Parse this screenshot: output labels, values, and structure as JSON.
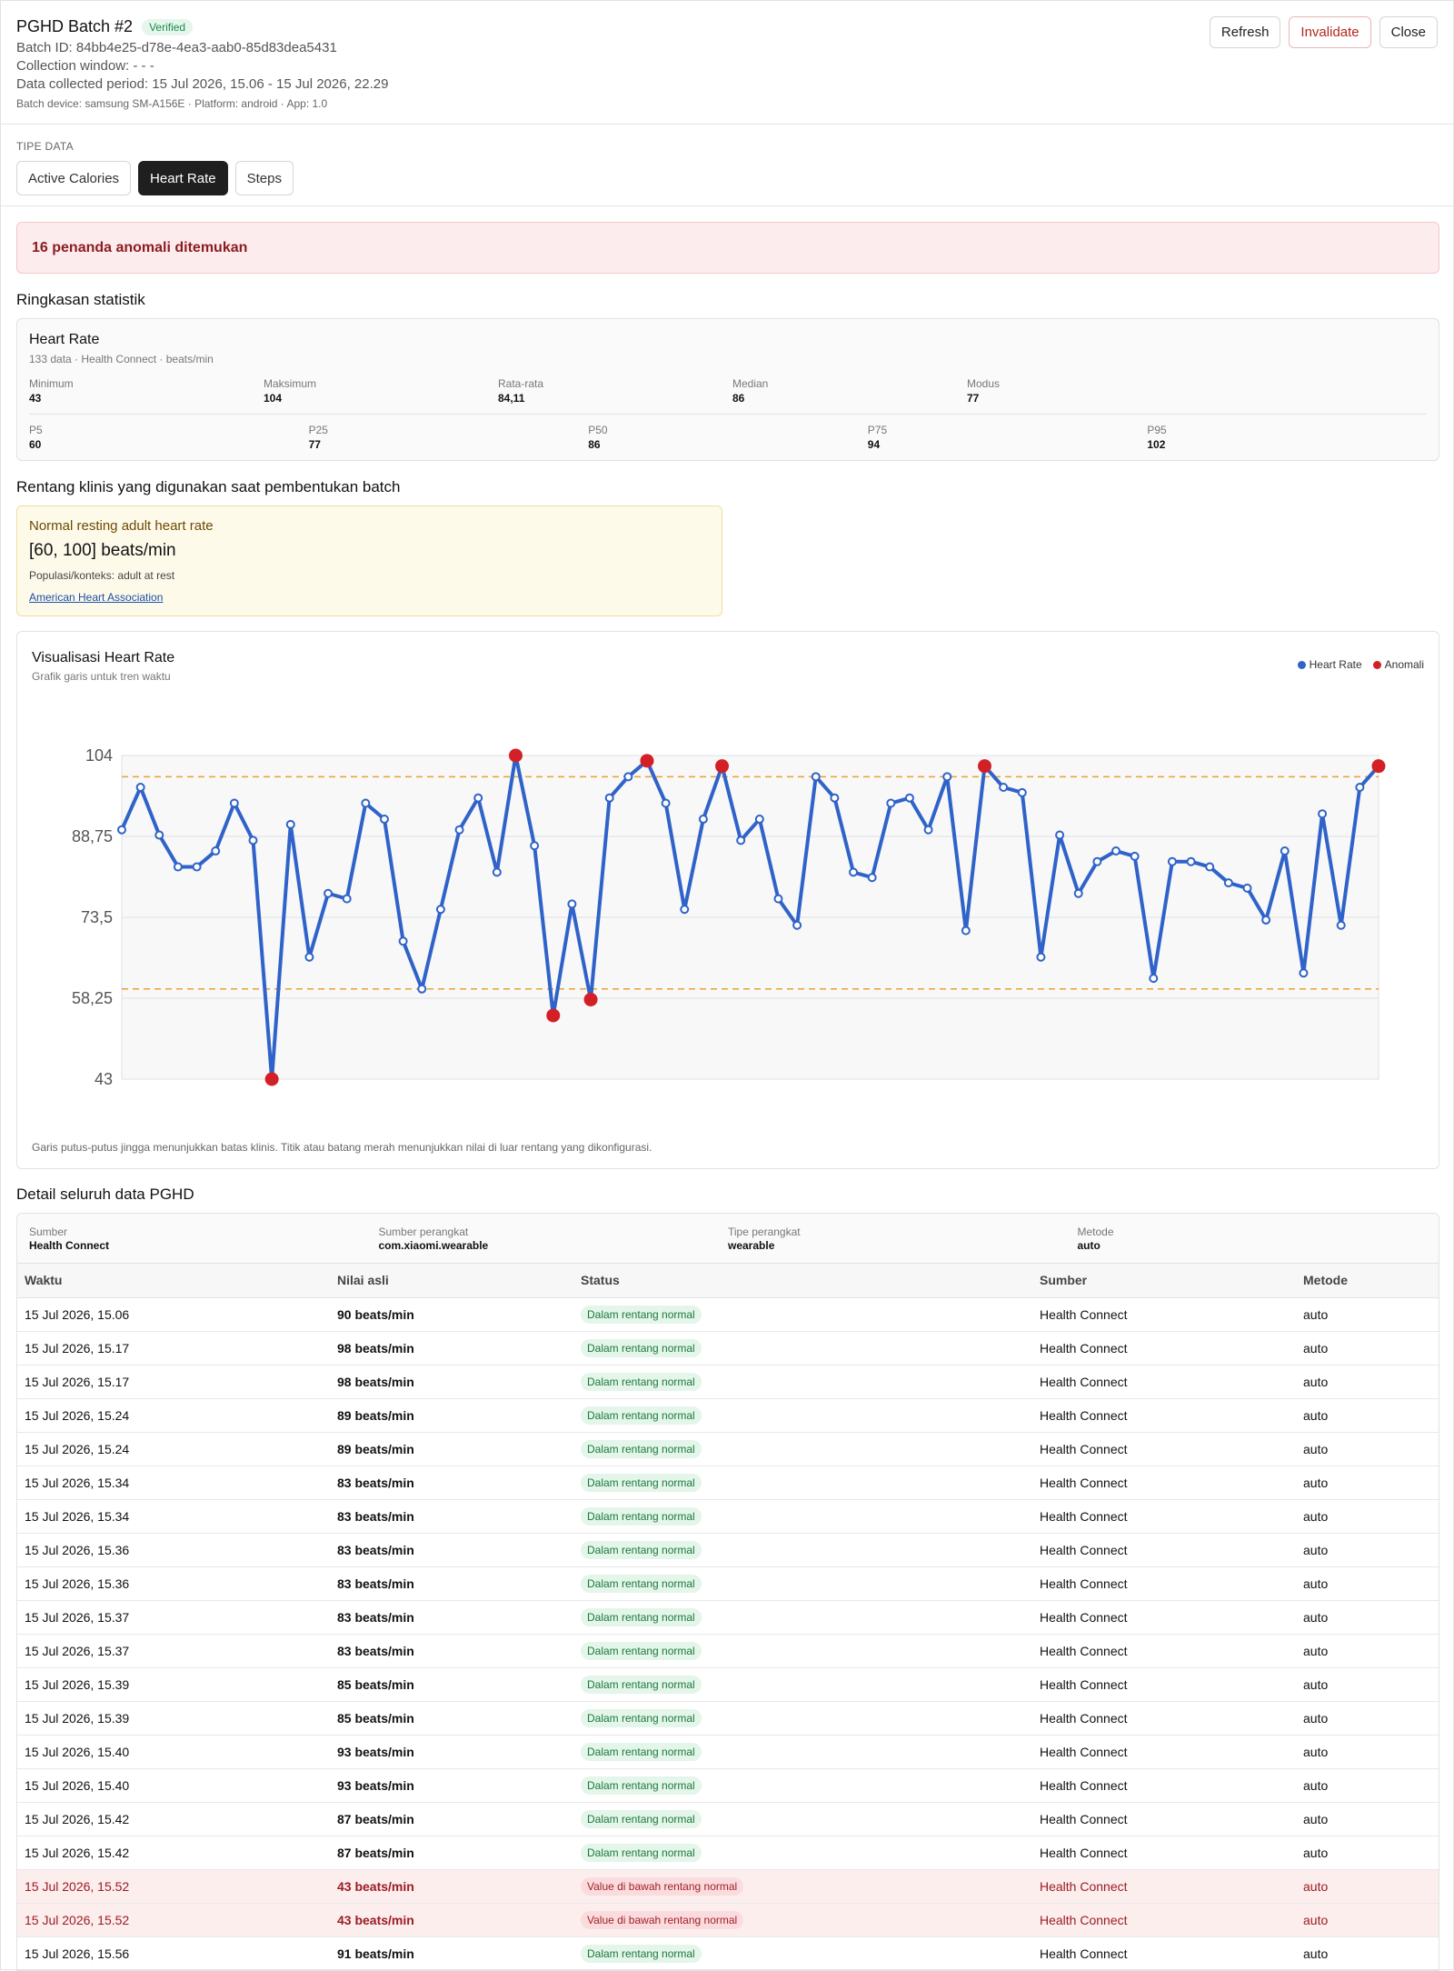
{
  "header": {
    "title": "PGHD Batch #2",
    "verified": "Verified",
    "batch_id": "Batch ID: 84bb4e25-d78e-4ea3-aab0-85d83dea5431",
    "collection_window": "Collection window: - - -",
    "period": "Data collected period: 15 Jul 2026, 15.06 - 15 Jul 2026, 22.29",
    "device": "Batch device: samsung SM-A156E · Platform: android · App: 1.0",
    "buttons": {
      "refresh": "Refresh",
      "invalidate": "Invalidate",
      "close": "Close"
    }
  },
  "types": {
    "label": "TIPE DATA",
    "tabs": [
      "Active Calories",
      "Heart Rate",
      "Steps"
    ],
    "active": "Heart Rate"
  },
  "alert": "16 penanda anomali ditemukan",
  "summary": {
    "section_title": "Ringkasan statistik",
    "title": "Heart Rate",
    "sub": "133 data · Health Connect · beats/min",
    "top": [
      {
        "k": "Minimum",
        "v": "43"
      },
      {
        "k": "Maksimum",
        "v": "104"
      },
      {
        "k": "Rata-rata",
        "v": "84,11"
      },
      {
        "k": "Median",
        "v": "86"
      },
      {
        "k": "Modus",
        "v": "77"
      }
    ],
    "bottom": [
      {
        "k": "P5",
        "v": "60"
      },
      {
        "k": "P25",
        "v": "77"
      },
      {
        "k": "P50",
        "v": "86"
      },
      {
        "k": "P75",
        "v": "94"
      },
      {
        "k": "P95",
        "v": "102"
      }
    ]
  },
  "clinical": {
    "section_title": "Rentang klinis yang digunakan saat pembentukan batch",
    "name": "Normal resting adult heart rate",
    "range": "[60, 100] beats/min",
    "population": "Populasi/konteks: adult at rest",
    "source": "American Heart Association"
  },
  "chart": {
    "title": "Visualisasi Heart Rate",
    "subtitle": "Grafik garis untuk tren waktu",
    "note": "Garis putus-putus jingga menunjukkan batas klinis. Titik atau batang merah menunjukkan nilai di luar rentang yang dikonfigurasi.",
    "colors": {
      "line": "#2f63c9",
      "anomaly": "#d32026",
      "limit": "#e8a235",
      "plot_bg": "#f8f8f8",
      "grid": "#e0e0e0"
    }
  },
  "chart_data": {
    "type": "line",
    "title": "Visualisasi Heart Rate",
    "ylim": [
      43,
      104
    ],
    "y_ticks": [
      "104",
      "88,75",
      "73,5",
      "58,25",
      "43"
    ],
    "y_tick_values": [
      104,
      88.75,
      73.5,
      58.25,
      43
    ],
    "limits": [
      60,
      100
    ],
    "grid": true,
    "legend_position": "top-right",
    "series": [
      {
        "name": "Heart Rate",
        "values": [
          90,
          98,
          89,
          83,
          83,
          86,
          95,
          88,
          43,
          91,
          66,
          78,
          77,
          95,
          92,
          69,
          60,
          75,
          90,
          96,
          82,
          104,
          87,
          55,
          76,
          58,
          96,
          100,
          103,
          95,
          75,
          92,
          102,
          88,
          92,
          77,
          72,
          100,
          96,
          82,
          81,
          95,
          96,
          90,
          100,
          71,
          102,
          98,
          97,
          66,
          89,
          78,
          84,
          86,
          85,
          62,
          84,
          84,
          83,
          80,
          79,
          73,
          86,
          63,
          93,
          72,
          98,
          102
        ]
      },
      {
        "name": "Anomali",
        "values": [
          43,
          104,
          55,
          58,
          103,
          101,
          102,
          102
        ]
      }
    ],
    "legend": [
      "Heart Rate",
      "Anomali"
    ]
  },
  "detail": {
    "section_title": "Detail seluruh data PGHD",
    "meta": [
      {
        "k": "Sumber",
        "v": "Health Connect"
      },
      {
        "k": "Sumber perangkat",
        "v": "com.xiaomi.wearable"
      },
      {
        "k": "Tipe perangkat",
        "v": "wearable"
      },
      {
        "k": "Metode",
        "v": "auto"
      }
    ],
    "columns": [
      "Waktu",
      "Nilai asli",
      "Status",
      "Sumber",
      "Metode"
    ],
    "rows": [
      {
        "time": "15 Jul 2026, 15.06",
        "value": "90 beats/min",
        "status": "Dalam rentang normal",
        "source": "Health Connect",
        "method": "auto",
        "anomaly": false
      },
      {
        "time": "15 Jul 2026, 15.17",
        "value": "98 beats/min",
        "status": "Dalam rentang normal",
        "source": "Health Connect",
        "method": "auto",
        "anomaly": false
      },
      {
        "time": "15 Jul 2026, 15.17",
        "value": "98 beats/min",
        "status": "Dalam rentang normal",
        "source": "Health Connect",
        "method": "auto",
        "anomaly": false
      },
      {
        "time": "15 Jul 2026, 15.24",
        "value": "89 beats/min",
        "status": "Dalam rentang normal",
        "source": "Health Connect",
        "method": "auto",
        "anomaly": false
      },
      {
        "time": "15 Jul 2026, 15.24",
        "value": "89 beats/min",
        "status": "Dalam rentang normal",
        "source": "Health Connect",
        "method": "auto",
        "anomaly": false
      },
      {
        "time": "15 Jul 2026, 15.34",
        "value": "83 beats/min",
        "status": "Dalam rentang normal",
        "source": "Health Connect",
        "method": "auto",
        "anomaly": false
      },
      {
        "time": "15 Jul 2026, 15.34",
        "value": "83 beats/min",
        "status": "Dalam rentang normal",
        "source": "Health Connect",
        "method": "auto",
        "anomaly": false
      },
      {
        "time": "15 Jul 2026, 15.36",
        "value": "83 beats/min",
        "status": "Dalam rentang normal",
        "source": "Health Connect",
        "method": "auto",
        "anomaly": false
      },
      {
        "time": "15 Jul 2026, 15.36",
        "value": "83 beats/min",
        "status": "Dalam rentang normal",
        "source": "Health Connect",
        "method": "auto",
        "anomaly": false
      },
      {
        "time": "15 Jul 2026, 15.37",
        "value": "83 beats/min",
        "status": "Dalam rentang normal",
        "source": "Health Connect",
        "method": "auto",
        "anomaly": false
      },
      {
        "time": "15 Jul 2026, 15.37",
        "value": "83 beats/min",
        "status": "Dalam rentang normal",
        "source": "Health Connect",
        "method": "auto",
        "anomaly": false
      },
      {
        "time": "15 Jul 2026, 15.39",
        "value": "85 beats/min",
        "status": "Dalam rentang normal",
        "source": "Health Connect",
        "method": "auto",
        "anomaly": false
      },
      {
        "time": "15 Jul 2026, 15.39",
        "value": "85 beats/min",
        "status": "Dalam rentang normal",
        "source": "Health Connect",
        "method": "auto",
        "anomaly": false
      },
      {
        "time": "15 Jul 2026, 15.40",
        "value": "93 beats/min",
        "status": "Dalam rentang normal",
        "source": "Health Connect",
        "method": "auto",
        "anomaly": false
      },
      {
        "time": "15 Jul 2026, 15.40",
        "value": "93 beats/min",
        "status": "Dalam rentang normal",
        "source": "Health Connect",
        "method": "auto",
        "anomaly": false
      },
      {
        "time": "15 Jul 2026, 15.42",
        "value": "87 beats/min",
        "status": "Dalam rentang normal",
        "source": "Health Connect",
        "method": "auto",
        "anomaly": false
      },
      {
        "time": "15 Jul 2026, 15.42",
        "value": "87 beats/min",
        "status": "Dalam rentang normal",
        "source": "Health Connect",
        "method": "auto",
        "anomaly": false
      },
      {
        "time": "15 Jul 2026, 15.52",
        "value": "43 beats/min",
        "status": "Value di bawah rentang normal",
        "source": "Health Connect",
        "method": "auto",
        "anomaly": true
      },
      {
        "time": "15 Jul 2026, 15.52",
        "value": "43 beats/min",
        "status": "Value di bawah rentang normal",
        "source": "Health Connect",
        "method": "auto",
        "anomaly": true
      },
      {
        "time": "15 Jul 2026, 15.56",
        "value": "91 beats/min",
        "status": "Dalam rentang normal",
        "source": "Health Connect",
        "method": "auto",
        "anomaly": false
      }
    ]
  }
}
